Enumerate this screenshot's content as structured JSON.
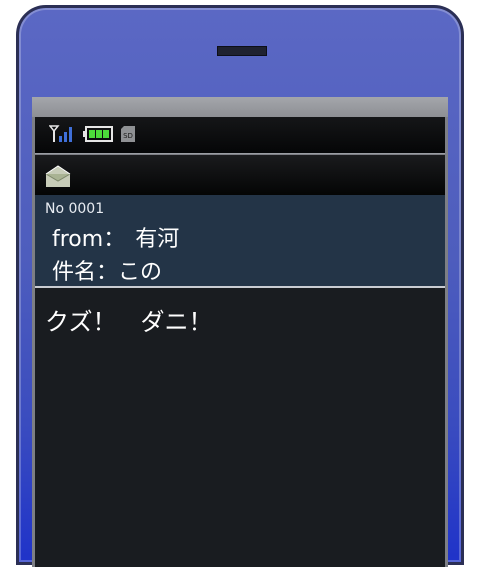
{
  "status": {
    "signal_icon": "signal-antenna-icon",
    "battery_icon": "battery-full-icon",
    "sd_label": "SD"
  },
  "title_bar": {
    "icon": "open-envelope-icon"
  },
  "message": {
    "number": "No 0001",
    "from_label": "from：",
    "from_value": "有河",
    "subject_label": "件名：",
    "subject_value": "この",
    "body": "クズ！　ダニ！"
  },
  "colors": {
    "phone_body": "#4e5dbd",
    "header_panel": "#233447",
    "body_panel": "#191c20",
    "battery": "#4cdc3a"
  }
}
